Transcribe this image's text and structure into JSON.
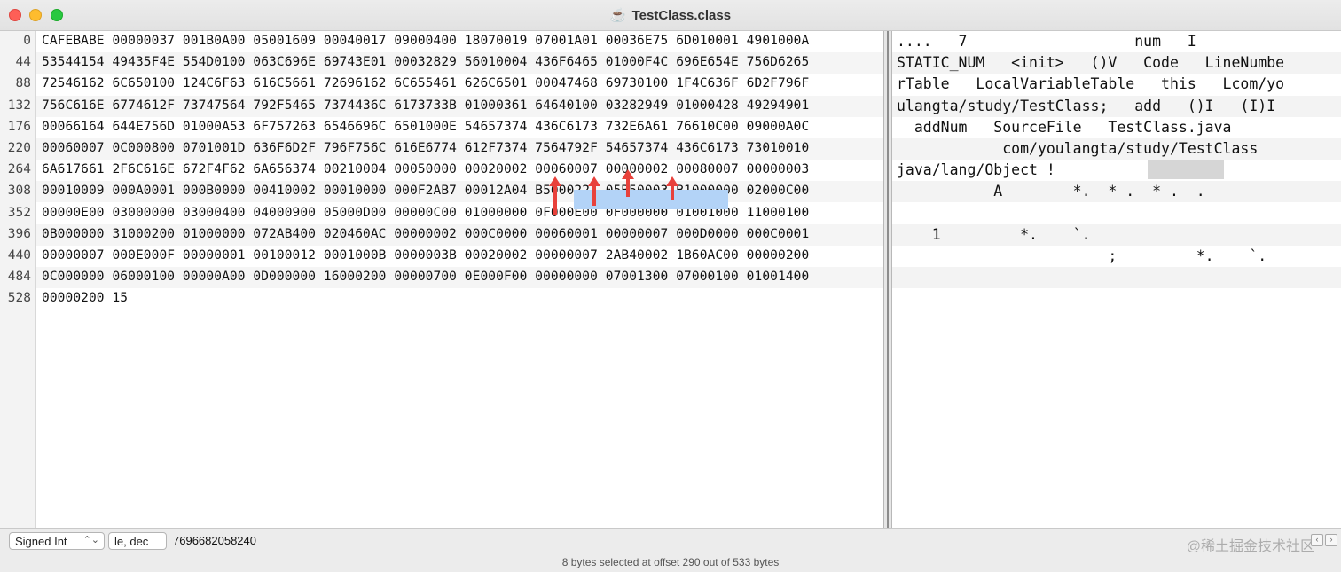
{
  "window": {
    "title": "TestClass.class",
    "title_icon": "coffee-cup-icon"
  },
  "line_offsets": [
    "0",
    "44",
    "88",
    "132",
    "176",
    "220",
    "264",
    "308",
    "352",
    "396",
    "440",
    "484",
    "528"
  ],
  "hex_rows": [
    "CAFEBABE 00000037 001B0A00 05001609 00040017 09000400 18070019 07001A01 00036E75 6D010001 4901000A",
    "53544154 49435F4E 554D0100 063C696E 69743E01 00032829 56010004 436F6465 01000F4C 696E654E 756D6265",
    "72546162 6C650100 124C6F63 616C5661 72696162 6C655461 626C6501 00047468 69730100 1F4C636F 6D2F796F",
    "756C616E 6774612F 73747564 792F5465 7374436C 6173733B 01000361 64640100 03282949 01000428 49294901",
    "00066164 644E756D 01000A53 6F757263 6546696C 6501000E 54657374 436C6173 732E6A61 76610C00 09000A0C",
    "00060007 0C000800 0701001D 636F6D2F 796F756C 616E6774 612F7374 7564792F 54657374 436C6173 73010010",
    "6A617661 2F6C616E 672F4F62 6A656374 00210004 00050000 00020002 00060007 00000002 00080007 00000003",
    "00010009 000A0001 000B0000 00410002 00010000 000F2AB7 00012A04 B500022A 05B50003 B1000000 02000C00",
    "00000E00 03000000 03000400 04000900 05000D00 00000C00 01000000 0F000E00 0F000000 01001000 11000100",
    "0B000000 31000200 01000000 072AB400 020460AC 00000002 000C0000 00060001 00000007 000D0000 000C0001",
    "00000007 000E000F 00000001 00100012 0001000B 0000003B 00020002 00000007 2AB40002 1B60AC00 00000200",
    "0C000000 06000100 00000A00 0D000000 16000200 00000700 0E000F00 00000000 07001300 07000100 01001400",
    "00000200 15"
  ],
  "text_rows": [
    "....   7                   num   I",
    "STATIC_NUM   <init>   ()V   Code   LineNumbe",
    "rTable   LocalVariableTable   this   Lcom/yo",
    "ulangta/study/TestClass;   add   ()I   (I)I",
    "  addNum   SourceFile   TestClass.java",
    "            com/youlangta/study/TestClass",
    "java/lang/Object !",
    "           A        *.  * .  * .  .",
    "",
    "    1         *.    `.",
    "                        ;         *.    `.",
    "",
    ""
  ],
  "bottom": {
    "type_select": "Signed Int",
    "endian_select": "le, dec",
    "value": "7696682058240",
    "status": "8 bytes selected at offset 290 out of 533 bytes",
    "watermark": "@稀土掘金技术社区"
  }
}
